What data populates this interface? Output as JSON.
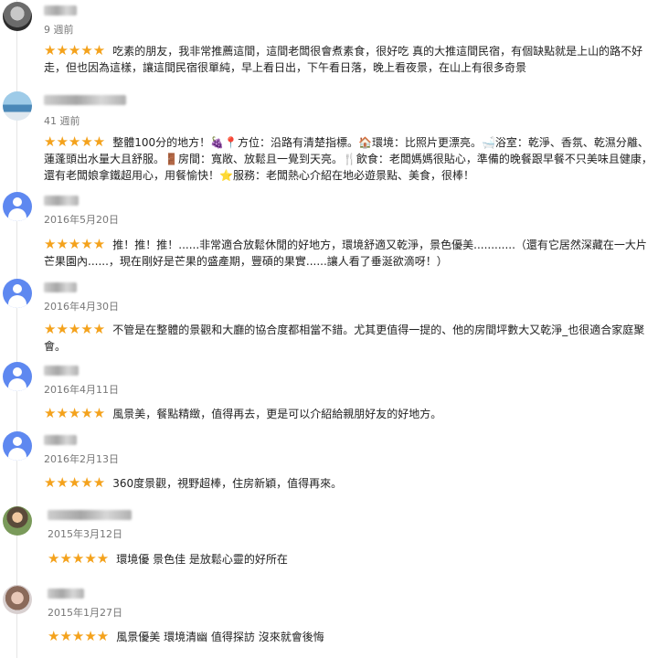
{
  "reviews": [
    {
      "name": "",
      "date": "9 週前",
      "rating": "★★★★★",
      "text": "吃素的朋友，我非常推薦這間，這間老闆很會煮素食，很好吃 真的大推這間民宿，有個缺點就是上山的路不好走，但也因為這樣，讓這間民宿很單純，早上看日出，下午看日落，晚上看夜景，在山上有很多奇景"
    },
    {
      "name": "",
      "date": "41 週前",
      "rating": "★★★★★",
      "text": "整體100分的地方！🍇📍方位：沿路有清楚指標。🏠環境：比照片更漂亮。🛁浴室：乾淨、香氛、乾濕分離、蓮蓬頭出水量大且舒服。🚪房間：寬敞、放鬆且一覺到天亮。🍴飲食：老闆媽媽很貼心，準備的晚餐跟早餐不只美味且健康，還有老闆娘拿鐵超用心，用餐愉快！⭐服務：老闆熱心介紹在地必遊景點、美食，很棒！"
    },
    {
      "name": "",
      "date": "2016年5月20日",
      "rating": "★★★★★",
      "text": "推！推！推！......非常適合放鬆休閒的好地方，環境舒適又乾淨，景色優美............（還有它居然深藏在一大片芒果園內......，現在剛好是芒果的盛產期，豐碩的果實......讓人看了垂涎欲滴呀！）"
    },
    {
      "name": "",
      "date": "2016年4月30日",
      "rating": "★★★★★",
      "text": "不管是在整體的景觀和大廳的協合度都相當不錯。尤其更值得一提的、他的房間坪數大又乾淨_也很適合家庭聚會。"
    },
    {
      "name": "",
      "date": "2016年4月11日",
      "rating": "★★★★★",
      "text": "風景美，餐點精緻，值得再去，更是可以介紹給親朋好友的好地方。"
    },
    {
      "name": "",
      "date": "2016年2月13日",
      "rating": "★★★★★",
      "text": "360度景觀，視野超棒，住房新穎，值得再來。"
    },
    {
      "name": "",
      "date": "2015年3月12日",
      "rating": "★★★★★",
      "text": "環境優 景色佳 是放鬆心靈的好所在"
    },
    {
      "name": "",
      "date": "2015年1月27日",
      "rating": "★★★★★",
      "text": "風景優美 環境清幽 值得探訪 沒來就會後悔"
    }
  ],
  "colors": {
    "star": "#f4a21c",
    "default_avatar": "#5e88f0",
    "date": "#777777"
  },
  "icons": {
    "default_avatar": "person-icon",
    "rating": "star-icon"
  }
}
